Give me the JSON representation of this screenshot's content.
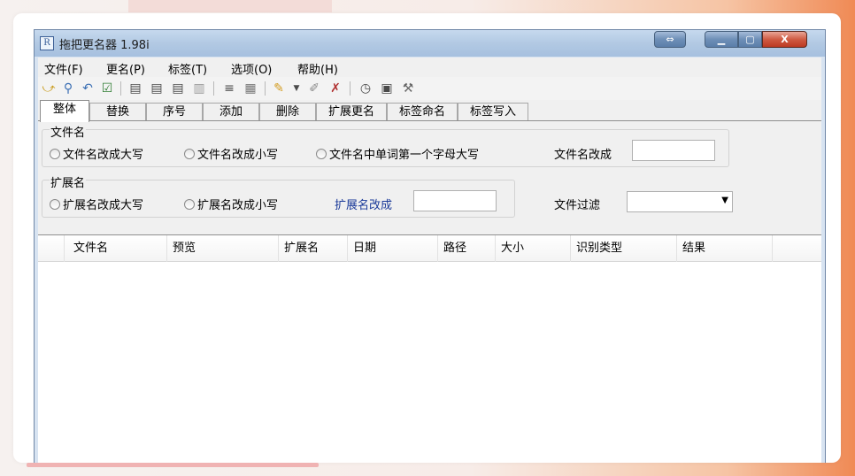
{
  "window": {
    "title": "拖把更名器 1.98i",
    "icon": "app-icon",
    "controls": [
      "restore-icon",
      "minimize-icon",
      "maximize-icon",
      "close-icon"
    ]
  },
  "menu": [
    "文件(F)",
    "更名(P)",
    "标签(T)",
    "选项(O)",
    "帮助(H)"
  ],
  "toolbar": {
    "icons": [
      "open-folder-icon",
      "search-icon",
      "undo-icon",
      "checkbox-icon",
      "tag-edit-icon-1",
      "tag-edit-icon-2",
      "tag-edit-icon-3",
      "tag-edit-icon-4",
      "list-icon",
      "properties-icon",
      "brush-icon",
      "dropdown-arrow-icon",
      "eraser-icon",
      "delete-tag-icon",
      "clock-icon",
      "panel-icon",
      "settings-tool-icon"
    ]
  },
  "tabs": [
    "整体",
    "替换",
    "序号",
    "添加",
    "删除",
    "扩展更名",
    "标签命名",
    "标签写入"
  ],
  "active_tab": "整体",
  "filename_group": {
    "label": "文件名",
    "options": [
      "文件名改成大写",
      "文件名改成小写",
      "文件名中单词第一个字母大写"
    ],
    "rename_label": "文件名改成",
    "rename_value": ""
  },
  "extension_group": {
    "label": "扩展名",
    "options": [
      "扩展名改成大写",
      "扩展名改成小写"
    ],
    "rename_label": "扩展名改成",
    "rename_value": ""
  },
  "filter": {
    "label": "文件过滤",
    "selected": ""
  },
  "list": {
    "columns": [
      "文件名",
      "预览",
      "扩展名",
      "日期",
      "路径",
      "大小",
      "识别类型",
      "结果"
    ],
    "rows": []
  }
}
